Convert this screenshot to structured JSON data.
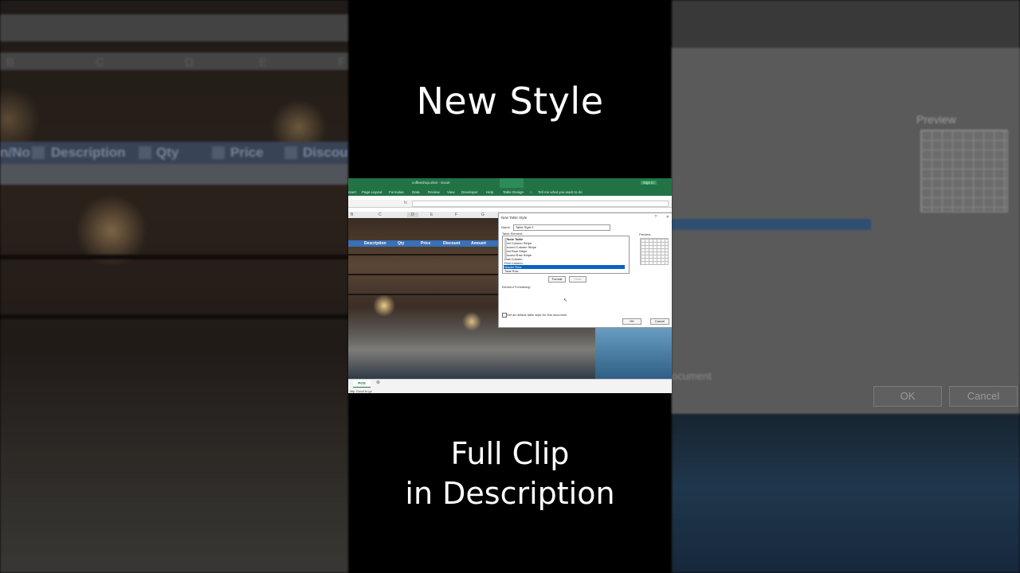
{
  "overlay": {
    "title": "New Style",
    "bottom_line1": "Full Clip",
    "bottom_line2": "in Description"
  },
  "excel": {
    "window_title": "coffeeshop.xlsm - Excel",
    "context_tab_group": "Table Tools",
    "sign_in": "Sign in",
    "ribbon_tabs": [
      "nsert",
      "Page Layout",
      "Formulas",
      "Data",
      "Review",
      "View",
      "Developer",
      "Help",
      "Table Design"
    ],
    "tell_me": "Tell me what you want to do",
    "formula_fx": "fx",
    "columns": [
      "B",
      "C",
      "D",
      "E",
      "F",
      "G"
    ],
    "table_headers": [
      "Description",
      "Qty",
      "Price",
      "Discount",
      "Amount"
    ],
    "sheet_tab": "POS",
    "status": "ility: Good to go"
  },
  "background": {
    "columns_left": [
      "B",
      "C",
      "D",
      "E",
      "F"
    ],
    "table_headers_left": [
      "n/No",
      "Description",
      "Qty",
      "Price",
      "Discou"
    ],
    "right_preview_label": "Preview",
    "right_buttons": [
      "OK",
      "Cancel"
    ],
    "right_text": "ocument"
  },
  "dialog": {
    "title": "New Table Style",
    "help": "?",
    "close": "✕",
    "name_label": "Name:",
    "name_value": "Table Style 1",
    "table_element_label": "Table Element:",
    "elements": [
      "Whole Table",
      "First Column Stripe",
      "Second Column Stripe",
      "First Row Stripe",
      "Second Row Stripe",
      "Last Column",
      "First Column",
      "Header Row",
      "Total Row"
    ],
    "selected_element": "Header Row",
    "preview_label": "Preview",
    "format_btn": "Format",
    "clear_btn": "Clear",
    "element_formatting_label": "Element Formatting:",
    "default_checkbox_label": "Set as default table style for this document",
    "ok": "OK",
    "cancel": "Cancel"
  }
}
